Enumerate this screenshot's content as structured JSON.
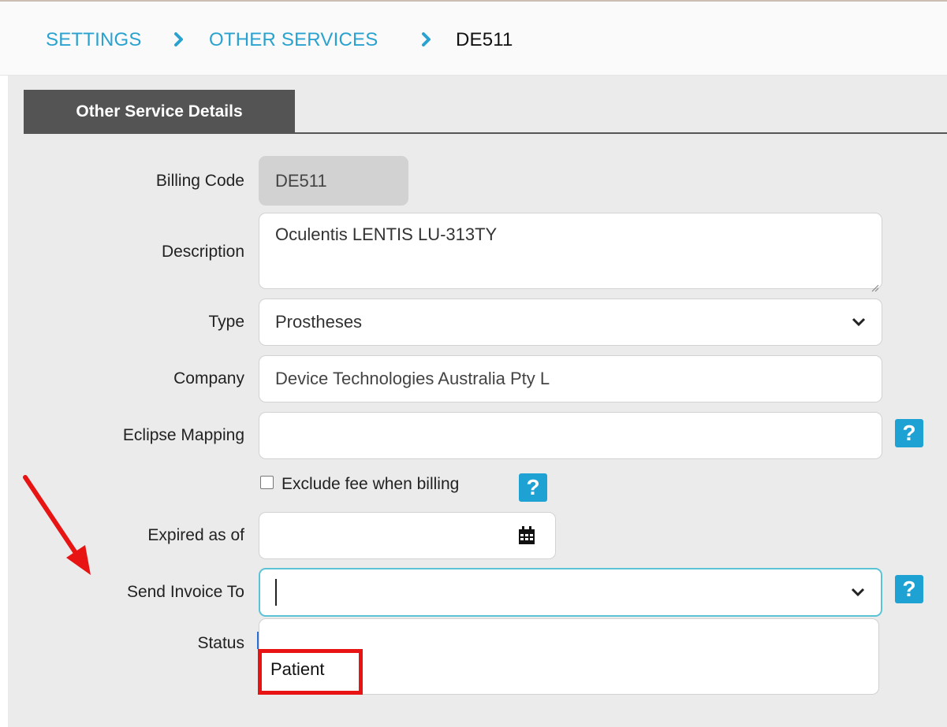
{
  "breadcrumb": {
    "items": [
      "SETTINGS",
      "OTHER SERVICES"
    ],
    "current": "DE511"
  },
  "tab": {
    "label": "Other Service Details"
  },
  "form": {
    "billing_code": {
      "label": "Billing Code",
      "value": "DE511"
    },
    "description": {
      "label": "Description",
      "value": "Oculentis LENTIS LU-313TY"
    },
    "type": {
      "label": "Type",
      "value": "Prostheses"
    },
    "company": {
      "label": "Company",
      "value": "Device Technologies Australia Pty L"
    },
    "eclipse_mapping": {
      "label": "Eclipse Mapping",
      "value": ""
    },
    "exclude_fee": {
      "label": "Exclude fee when billing",
      "checked": false
    },
    "expired_as_of": {
      "label": "Expired as of",
      "value": ""
    },
    "send_invoice_to": {
      "label": "Send Invoice To",
      "value": "",
      "options": [
        "",
        "Patient"
      ]
    },
    "status": {
      "label": "Status"
    }
  },
  "help": {
    "symbol": "?"
  },
  "icons": {
    "breadcrumb_separator": "chevron-right-icon",
    "select_arrow": "chevron-down-icon",
    "calendar": "calendar-icon",
    "help": "help-icon"
  },
  "colors": {
    "link": "#2aa2d0",
    "tab_bg": "#545454",
    "help_bg": "#1ea2d4",
    "focus_border": "#5bc3d6",
    "highlight": "#e81414",
    "annotation_arrow": "#e81414"
  }
}
